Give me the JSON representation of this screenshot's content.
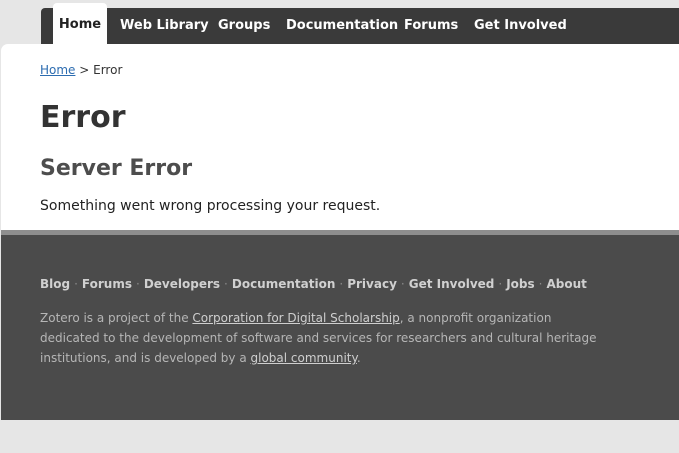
{
  "nav": {
    "tabs": [
      {
        "label": "Home",
        "active": true
      },
      {
        "label": "Web Library"
      },
      {
        "label": "Groups"
      },
      {
        "label": "Documentation"
      },
      {
        "label": "Forums"
      },
      {
        "label": "Get Involved"
      }
    ]
  },
  "breadcrumb": {
    "home": "Home",
    "separator": " > ",
    "current": "Error"
  },
  "main": {
    "title": "Error",
    "heading": "Server Error",
    "message": "Something went wrong processing your request."
  },
  "footer": {
    "links": [
      "Blog",
      "Forums",
      "Developers",
      "Documentation",
      "Privacy",
      "Get Involved",
      "Jobs",
      "About"
    ],
    "separator": "·",
    "text_part1": "Zotero is a project of the ",
    "org_link": "Corporation for Digital Scholarship",
    "text_part2": ", a nonprofit organization dedicated to the development of software and services for researchers and cultural heritage institutions, and is developed by a ",
    "community_link": "global community",
    "text_part3": "."
  },
  "colors": {
    "nav_background": "#3a3a3a",
    "footer_background": "#4b4b4b",
    "link_blue": "#2c6cb0"
  }
}
